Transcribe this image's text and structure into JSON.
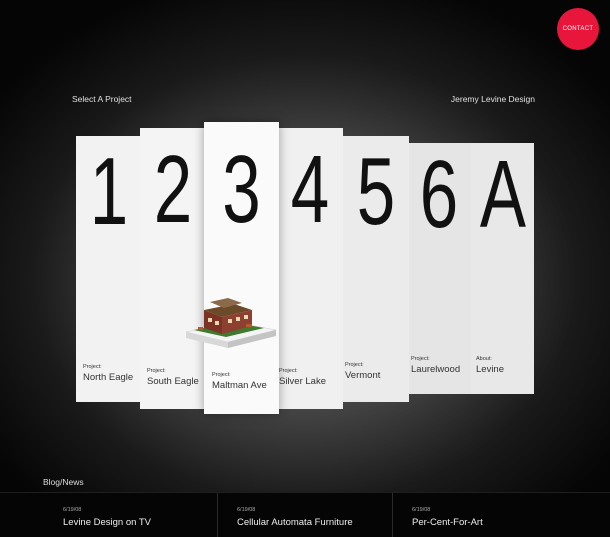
{
  "header": {
    "contact_label": "CONTACT",
    "select_label": "Select A Project",
    "studio_name": "Jeremy Levine Design"
  },
  "colors": {
    "contact_badge": "#e8163b",
    "background_center": "#8c8c8c",
    "background_edge": "#050505"
  },
  "cards": [
    {
      "number": "1",
      "caption": "Project:",
      "name": "North Eagle"
    },
    {
      "number": "2",
      "caption": "Project:",
      "name": "South Eagle"
    },
    {
      "number": "3",
      "caption": "Project:",
      "name": "Maltman Ave"
    },
    {
      "number": "4",
      "caption": "Project:",
      "name": "Silver Lake"
    },
    {
      "number": "5",
      "caption": "Project:",
      "name": "Vermont"
    },
    {
      "number": "6",
      "caption": "Project:",
      "name": "Laurelwood"
    },
    {
      "number": "A",
      "caption": "About:",
      "name": "Levine"
    }
  ],
  "blog": {
    "title": "Blog/News",
    "items": [
      {
        "date": "6/19/08",
        "headline": "Levine Design on TV"
      },
      {
        "date": "6/19/08",
        "headline": "Cellular Automata Furniture"
      },
      {
        "date": "6/19/08",
        "headline": "Per-Cent-For-Art"
      }
    ]
  }
}
